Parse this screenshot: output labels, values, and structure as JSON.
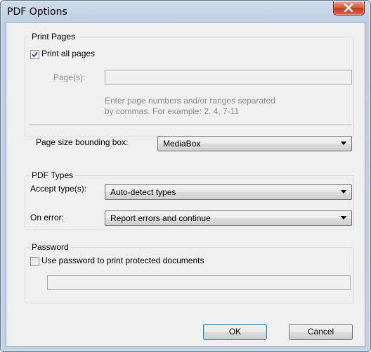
{
  "window": {
    "title": "PDF Options"
  },
  "print_pages": {
    "title": "Print Pages",
    "print_all_label": "Print all pages",
    "print_all_checked": true,
    "pages_label": "Page(s):",
    "pages_value": "",
    "hint_line1": "Enter page numbers and/or ranges separated",
    "hint_line2": "by commas.  For example: 2, 4, 7-11"
  },
  "page_size": {
    "label": "Page size bounding box:",
    "selected": "MediaBox"
  },
  "pdf_types": {
    "title": "PDF Types",
    "accept_label": "Accept type(s):",
    "accept_selected": "Auto-detect types",
    "on_error_label": "On error:",
    "on_error_selected": "Report errors and continue"
  },
  "password": {
    "title": "Password",
    "use_password_label": "Use password to print protected documents",
    "use_password_checked": false,
    "password_value": ""
  },
  "buttons": {
    "ok": "OK",
    "cancel": "Cancel"
  }
}
